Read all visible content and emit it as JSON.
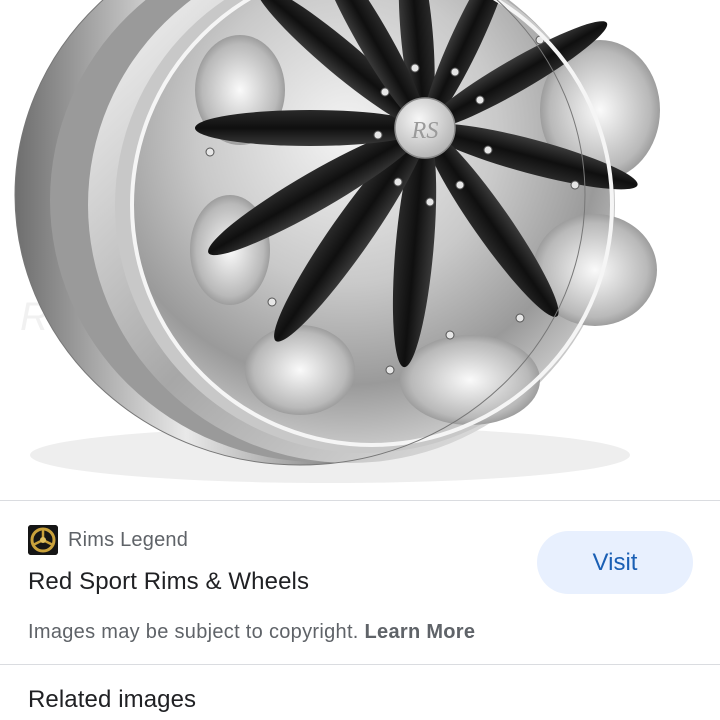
{
  "result": {
    "image_subject": "chrome-wheel-rim",
    "hub_logo": "RS"
  },
  "source": {
    "site_name": "Rims Legend",
    "favicon_icon": "rims-legend-logo-icon"
  },
  "title": "Red Sport Rims & Wheels",
  "visit_label": "Visit",
  "copyright": {
    "text": "Images may be subject to copyright.",
    "link_label": "Learn More"
  },
  "related_heading": "Related images",
  "colors": {
    "visit_bg": "#e8f0fe",
    "visit_text": "#1a5fb4",
    "divider": "#dadce0",
    "muted_text": "#5f6368",
    "primary_text": "#202124"
  }
}
